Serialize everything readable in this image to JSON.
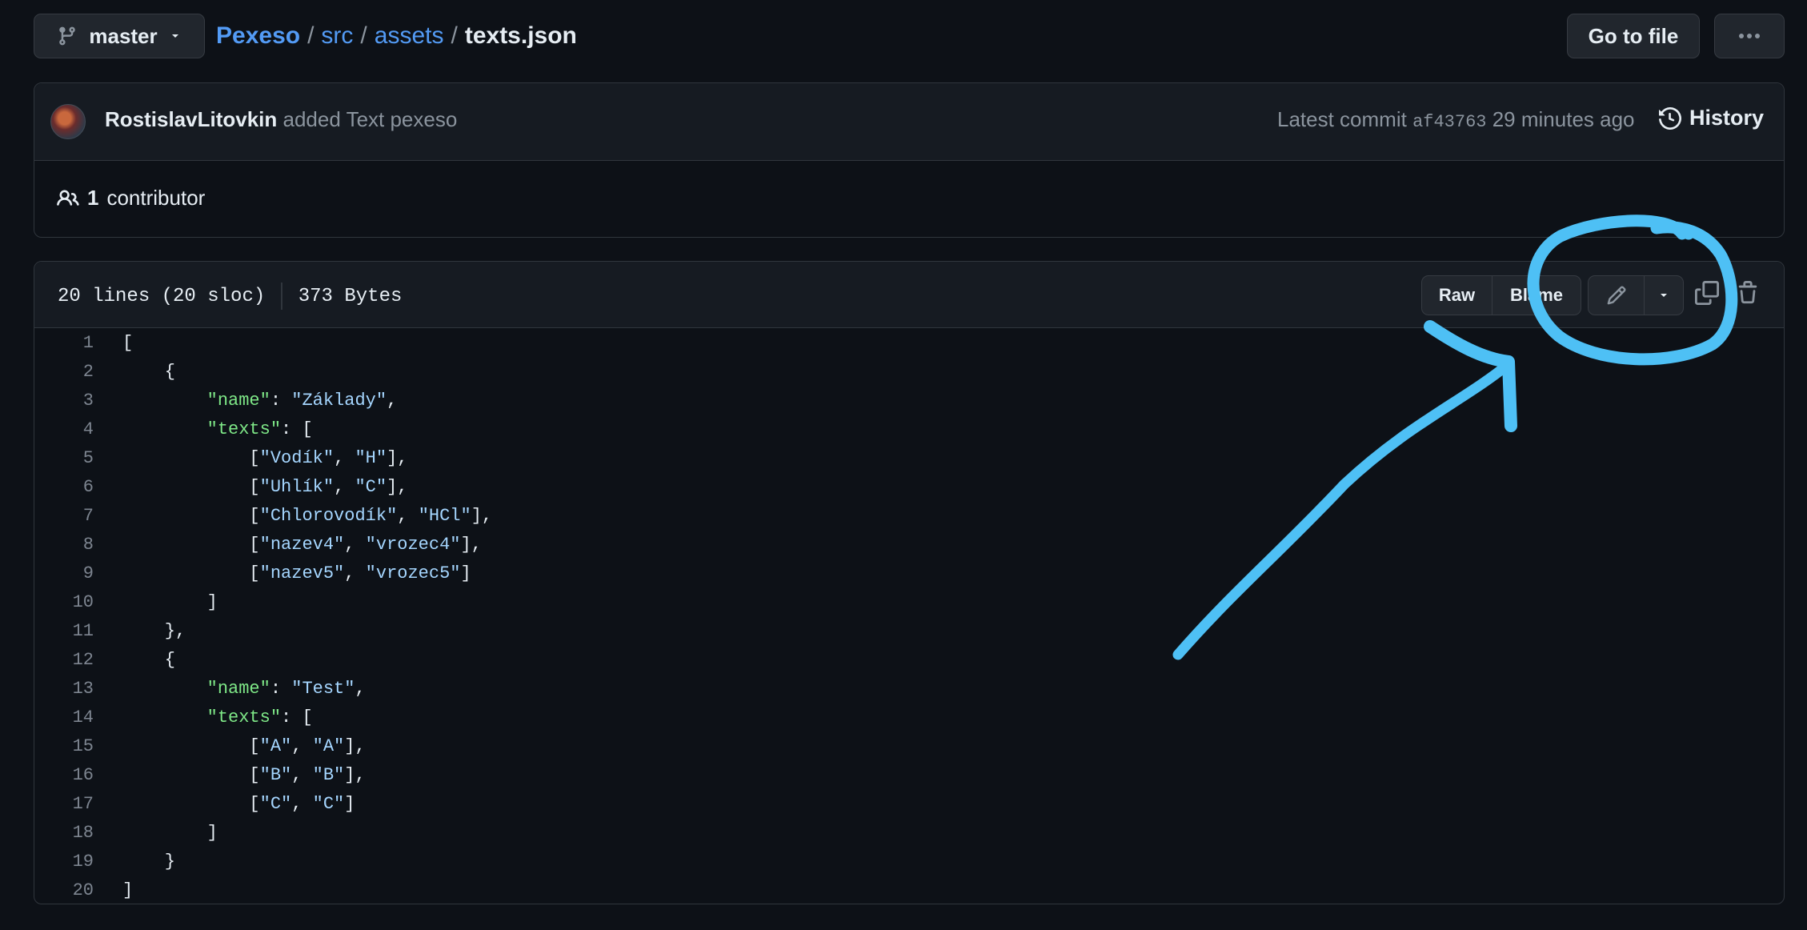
{
  "branch": {
    "name": "master",
    "icon": "git-branch-icon"
  },
  "breadcrumb": {
    "repo": "Pexeso",
    "sep": "/",
    "dir1": "src",
    "dir2": "assets",
    "file": "texts.json"
  },
  "header_actions": {
    "goto_label": "Go to file",
    "more_icon": "kebab-horizontal-icon"
  },
  "commit": {
    "author": "RostislavLitovkin",
    "message": "added Text pexeso",
    "latest_label": "Latest commit",
    "sha": "af43763",
    "time": "29 minutes ago",
    "history_label": "History"
  },
  "contributors": {
    "count": "1",
    "label": "contributor"
  },
  "file": {
    "lines_info": "20 lines (20 sloc)",
    "size": "373 Bytes",
    "raw_label": "Raw",
    "blame_label": "Blame",
    "icons": [
      "pencil-icon",
      "triangle-down-icon",
      "copy-icon",
      "trash-icon"
    ]
  },
  "code_lines": [
    {
      "n": "1",
      "html": "["
    },
    {
      "n": "2",
      "html": "    {"
    },
    {
      "n": "3",
      "html": "        <span class=\"k\">\"name\"</span>: <span class=\"s\">\"Základy\"</span>,"
    },
    {
      "n": "4",
      "html": "        <span class=\"k\">\"texts\"</span>: ["
    },
    {
      "n": "5",
      "html": "            [<span class=\"s\">\"Vodík\"</span>, <span class=\"s\">\"H\"</span>],"
    },
    {
      "n": "6",
      "html": "            [<span class=\"s\">\"Uhlík\"</span>, <span class=\"s\">\"C\"</span>],"
    },
    {
      "n": "7",
      "html": "            [<span class=\"s\">\"Chlorovodík\"</span>, <span class=\"s\">\"HCl\"</span>],"
    },
    {
      "n": "8",
      "html": "            [<span class=\"s\">\"nazev4\"</span>, <span class=\"s\">\"vrozec4\"</span>],"
    },
    {
      "n": "9",
      "html": "            [<span class=\"s\">\"nazev5\"</span>, <span class=\"s\">\"vrozec5\"</span>]"
    },
    {
      "n": "10",
      "html": "        ]"
    },
    {
      "n": "11",
      "html": "    },"
    },
    {
      "n": "12",
      "html": "    {"
    },
    {
      "n": "13",
      "html": "        <span class=\"k\">\"name\"</span>: <span class=\"s\">\"Test\"</span>,"
    },
    {
      "n": "14",
      "html": "        <span class=\"k\">\"texts\"</span>: ["
    },
    {
      "n": "15",
      "html": "            [<span class=\"s\">\"A\"</span>, <span class=\"s\">\"A\"</span>],"
    },
    {
      "n": "16",
      "html": "            [<span class=\"s\">\"B\"</span>, <span class=\"s\">\"B\"</span>],"
    },
    {
      "n": "17",
      "html": "            [<span class=\"s\">\"C\"</span>, <span class=\"s\">\"C\"</span>]"
    },
    {
      "n": "18",
      "html": "        ]"
    },
    {
      "n": "19",
      "html": "    }"
    },
    {
      "n": "20",
      "html": "]"
    }
  ],
  "annotation": {
    "color": "#4ec0f5",
    "shapes": [
      "circle-highlight",
      "arrow"
    ]
  },
  "colors": {
    "bg": "#0d1117",
    "panel": "#161b22",
    "link": "#539bf5",
    "key": "#7ee787",
    "string": "#a5d6ff"
  }
}
